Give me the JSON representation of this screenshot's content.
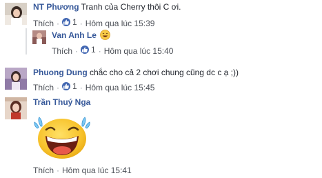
{
  "comments": [
    {
      "name": "NT Phương",
      "text": "Tranh của Cherry thôi C ơi.",
      "like_label": "Thích",
      "like_count": "1",
      "time": "Hôm qua lúc 15:39"
    },
    {
      "name": "Van Anh Le",
      "text": "",
      "like_label": "Thích",
      "like_count": "1",
      "time": "Hôm qua lúc 15:40"
    },
    {
      "name": "Phuong Dung",
      "text": "chắc cho cả 2 chơi chung cũng dc c ạ ;))",
      "like_label": "Thích",
      "like_count": "1",
      "time": "Hôm qua lúc 15:45"
    },
    {
      "name": "Trần Thuý Nga",
      "text": "",
      "like_label": "Thích",
      "time": "Hôm qua lúc 15:41"
    }
  ],
  "separator": "·",
  "icons": {
    "like": "like-thumb-icon",
    "smile": "smile-emoji-icon",
    "sticker": "laughing-tears-sticker"
  },
  "colors": {
    "name": "#365899",
    "meta": "#90949c",
    "like_badge": "#4267b2"
  }
}
